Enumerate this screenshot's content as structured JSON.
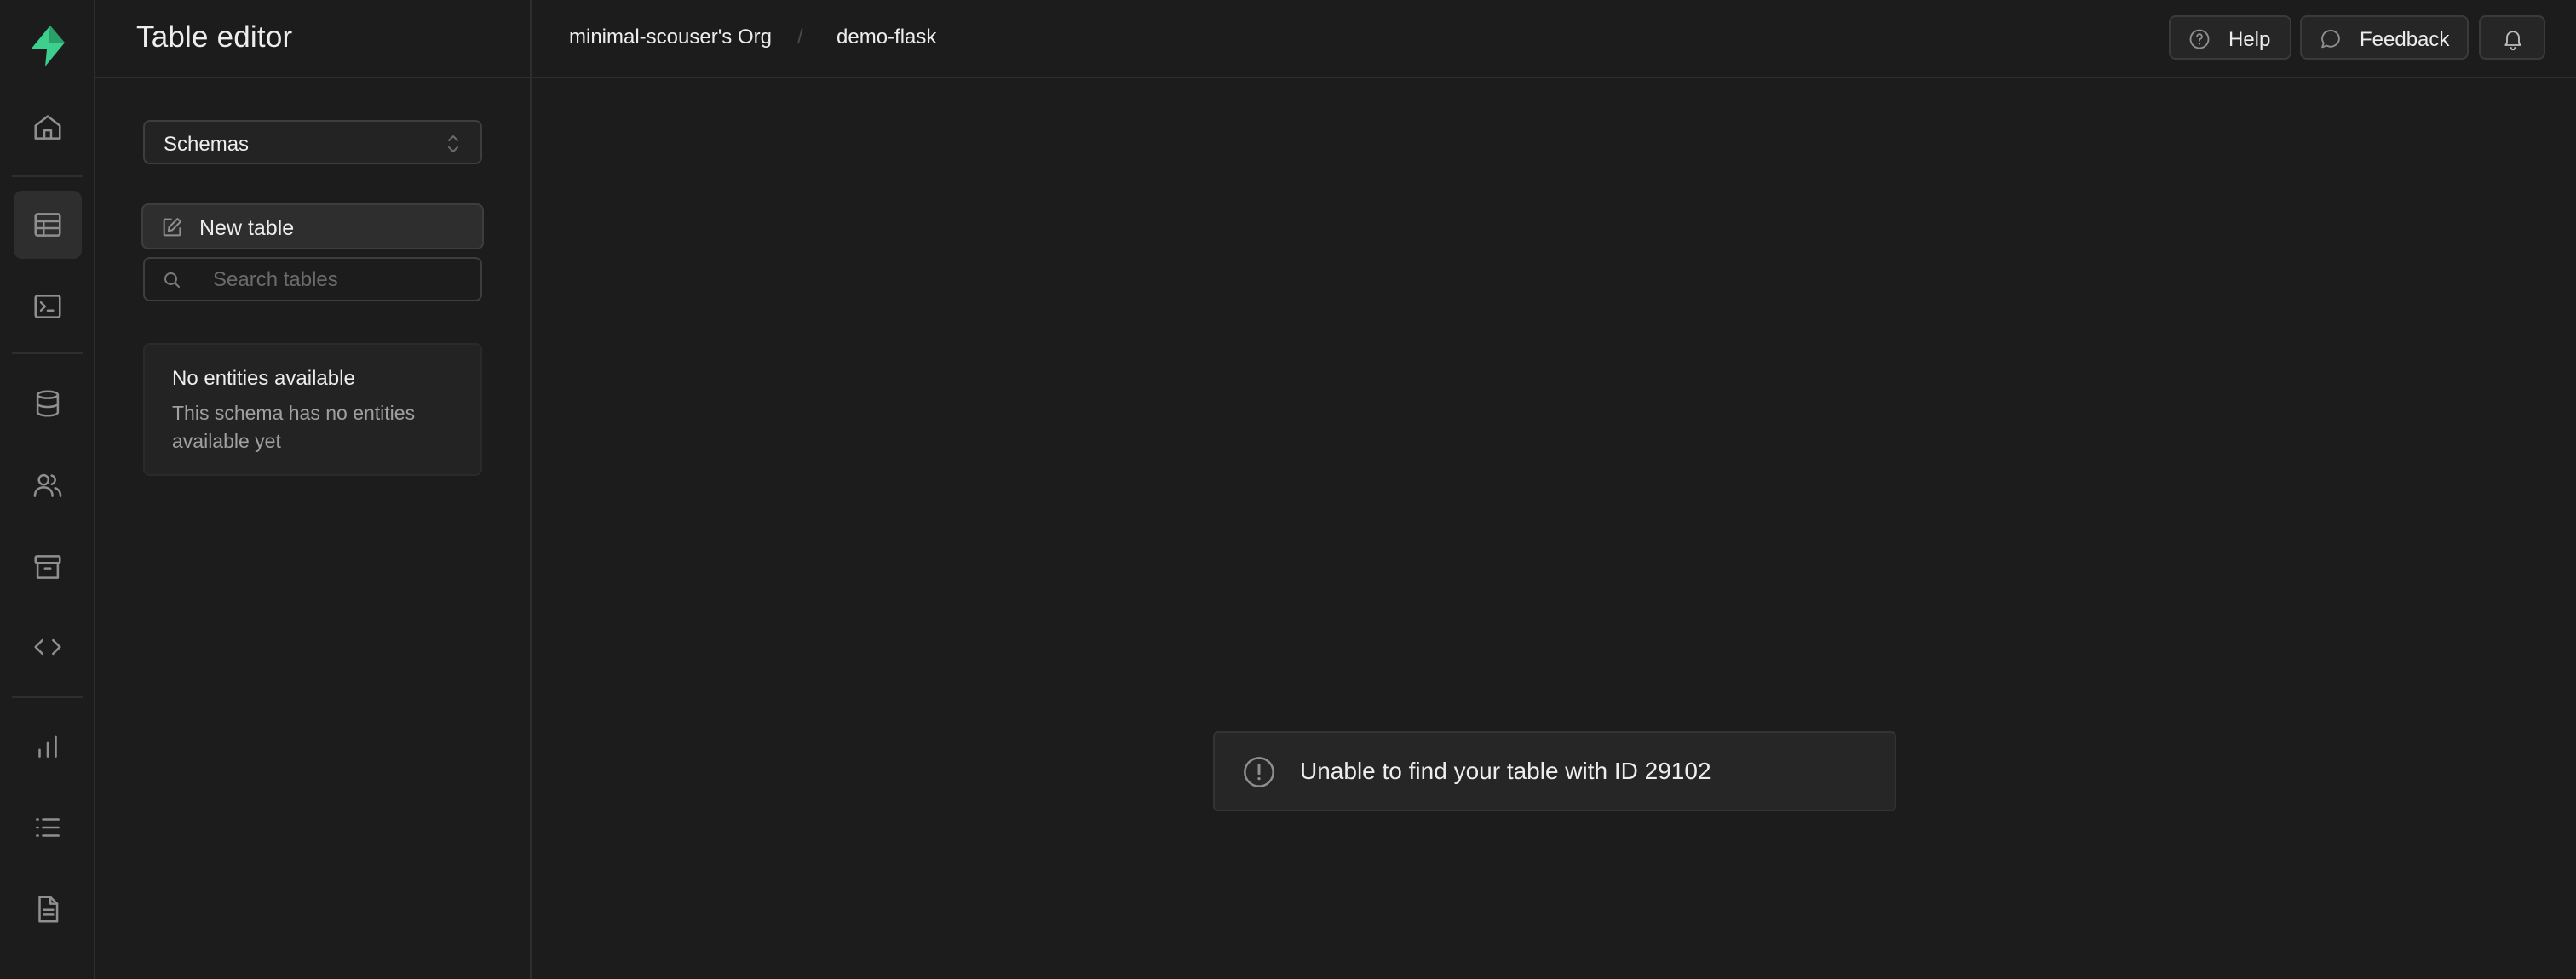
{
  "colors": {
    "brand": "#3ecf8e",
    "background": "#1c1c1c",
    "border": "#2e2e2e"
  },
  "rail": {
    "logo_icon": "supabase-logo-icon",
    "items": [
      {
        "icon": "home-icon",
        "active": false
      },
      {
        "icon": "table-icon",
        "active": true
      },
      {
        "icon": "terminal-icon",
        "active": false
      },
      {
        "icon": "database-icon",
        "active": false
      },
      {
        "icon": "users-icon",
        "active": false
      },
      {
        "icon": "archive-icon",
        "active": false
      },
      {
        "icon": "code-icon",
        "active": false
      },
      {
        "icon": "bar-chart-icon",
        "active": false
      },
      {
        "icon": "list-icon",
        "active": false
      },
      {
        "icon": "document-icon",
        "active": false
      }
    ]
  },
  "sidebar": {
    "title": "Table editor",
    "schema_select": {
      "value": "Schemas"
    },
    "new_table_label": "New table",
    "search": {
      "placeholder": "Search tables",
      "value": ""
    },
    "empty_state": {
      "title": "No entities available",
      "description": "This schema has no entities available yet"
    }
  },
  "header": {
    "breadcrumb": {
      "org": "minimal-scouser's Org",
      "separator": "/",
      "project": "demo-flask"
    },
    "help_label": "Help",
    "feedback_label": "Feedback"
  },
  "main": {
    "message": "Unable to find your table with ID 29102"
  }
}
